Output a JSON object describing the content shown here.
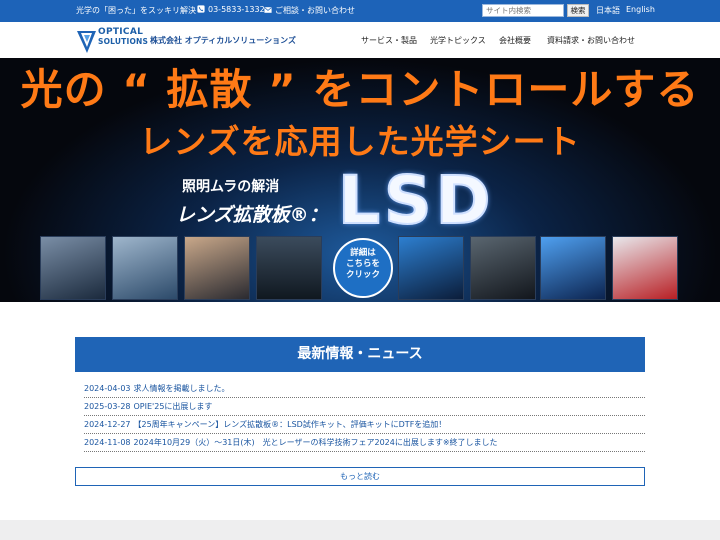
{
  "topbar": {
    "tagline": "光学の「困った」をスッキリ解決",
    "phone": "03-5833-1332",
    "contact": "ご相談・お問い合わせ",
    "search_placeholder": "サイト内検索",
    "search_button": "検索",
    "lang_ja": "日本語",
    "lang_en": "English"
  },
  "header": {
    "logo_line1": "OPTICAL",
    "logo_line2": "SOLUTIONS",
    "company_name": "株式会社 オプティカルソリューションズ",
    "nav": [
      "サービス・製品",
      "光学トピックス",
      "会社概要",
      "資料請求・お問い合わせ"
    ]
  },
  "hero": {
    "title_line1": "光の “ 拡散 ” をコントロールする",
    "title_line2": "レンズを応用した光学シート",
    "subtitle": "照明ムラの解消",
    "product": "レンズ拡散板®：",
    "product_logo": "LSD",
    "badge_lines": [
      "詳細は",
      "こちらを",
      "クリック"
    ]
  },
  "news": {
    "heading": "最新情報・ニュース",
    "items": [
      {
        "date": "2024-04-03",
        "text": "求人情報を掲載しました。"
      },
      {
        "date": "2025-03-28",
        "text": "OPIE'25に出展します"
      },
      {
        "date": "2024-12-27",
        "text": "【25周年キャンペーン】レンズ拡散板®：LSD試作キット、評価キットにDTFを追加！"
      },
      {
        "date": "2024-11-08",
        "text": "2024年10月29（火）～31日(木)　光とレーザーの科学技術フェア2024に出展します※終了しました"
      }
    ],
    "more_label": "もっと読む"
  },
  "colors": {
    "brand_blue": "#1f64b6",
    "hero_orange": "#ff7a16"
  }
}
